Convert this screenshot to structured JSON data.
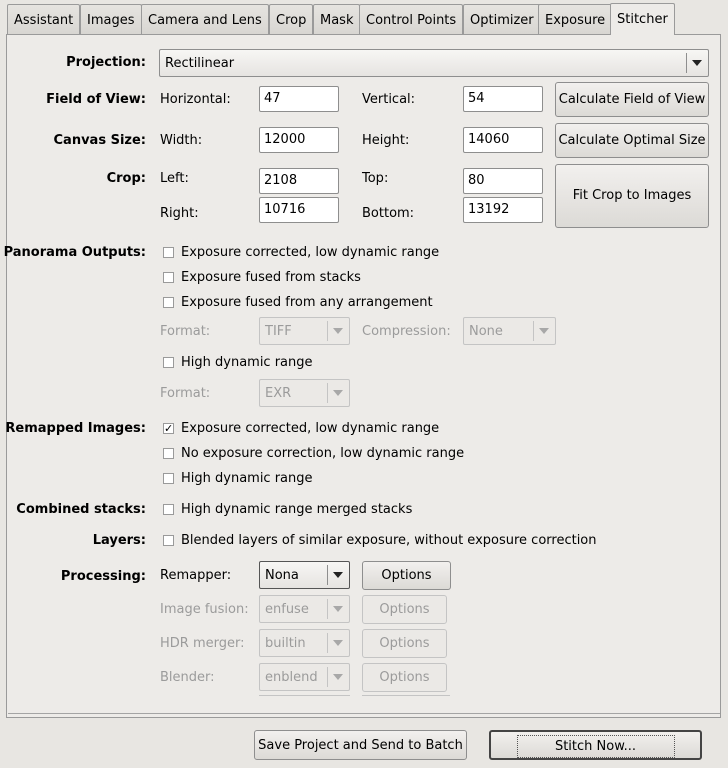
{
  "tabs": [
    "Assistant",
    "Images",
    "Camera and Lens",
    "Crop",
    "Mask",
    "Control Points",
    "Optimizer",
    "Exposure",
    "Stitcher"
  ],
  "projection": {
    "label": "Projection:",
    "value": "Rectilinear"
  },
  "fov": {
    "label": "Field of View:",
    "horizontal_label": "Horizontal:",
    "horizontal": "47",
    "vertical_label": "Vertical:",
    "vertical": "54",
    "button": "Calculate Field of View"
  },
  "canvas": {
    "label": "Canvas Size:",
    "width_label": "Width:",
    "width": "12000",
    "height_label": "Height:",
    "height": "14060",
    "button": "Calculate Optimal Size"
  },
  "crop": {
    "label": "Crop:",
    "left_label": "Left:",
    "left": "2108",
    "top_label": "Top:",
    "top": "80",
    "right_label": "Right:",
    "right": "10716",
    "bottom_label": "Bottom:",
    "bottom": "13192",
    "button": "Fit Crop to Images"
  },
  "panorama_outputs": {
    "label": "Panorama Outputs:",
    "opt1": "Exposure corrected, low dynamic range",
    "opt2": "Exposure fused from stacks",
    "opt3": "Exposure fused from any arrangement",
    "format_label": "Format:",
    "format": "TIFF",
    "compression_label": "Compression:",
    "compression": "None",
    "hdr": "High dynamic range",
    "hdr_format_label": "Format:",
    "hdr_format": "EXR",
    "checked": [
      false,
      false,
      false,
      false
    ]
  },
  "remapped": {
    "label": "Remapped Images:",
    "opt1": "Exposure corrected, low dynamic range",
    "opt2": "No exposure correction, low dynamic range",
    "opt3": "High dynamic range",
    "checked": [
      true,
      false,
      false
    ]
  },
  "combined": {
    "label": "Combined stacks:",
    "opt": "High dynamic range merged stacks",
    "checked": false
  },
  "layers": {
    "label": "Layers:",
    "opt": "Blended layers of similar exposure, without exposure correction",
    "checked": false
  },
  "processing": {
    "label": "Processing:",
    "remapper_label": "Remapper:",
    "remapper": "Nona",
    "fusion_label": "Image fusion:",
    "fusion": "enfuse",
    "hdr_label": "HDR merger:",
    "hdr": "builtin",
    "blender_label": "Blender:",
    "blender": "enblend",
    "options": "Options"
  },
  "footer": {
    "batch_button": "Save Project and Send to Batch",
    "stitch_button": "Stitch Now..."
  },
  "check_mark": "✓"
}
